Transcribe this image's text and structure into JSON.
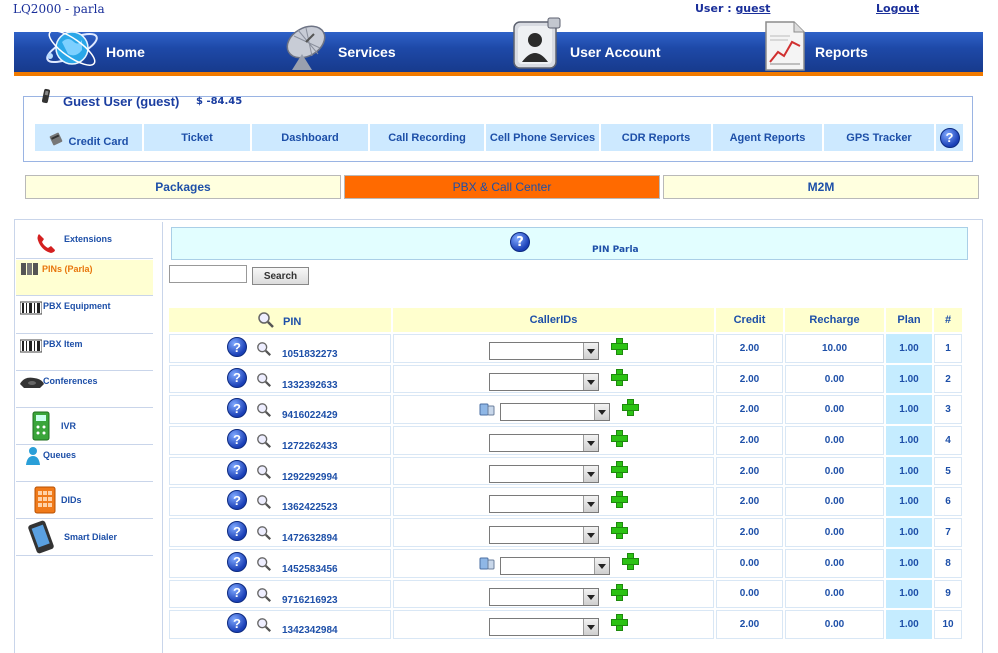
{
  "header": {
    "site_title": "LQ2000 - parla",
    "user_label": "User :",
    "user_name": "guest",
    "logout": "Logout"
  },
  "nav": {
    "items": [
      {
        "label": "Home",
        "icon": "globe-icon"
      },
      {
        "label": "Services",
        "icon": "satellite-dish-icon"
      },
      {
        "label": "User Account",
        "icon": "user-account-icon"
      },
      {
        "label": "Reports",
        "icon": "report-chart-icon"
      }
    ]
  },
  "profile": {
    "name": "Guest User (guest)",
    "balance": "$ -84.45"
  },
  "subtabs": [
    {
      "label": "Credit Card"
    },
    {
      "label": "Ticket"
    },
    {
      "label": "Dashboard"
    },
    {
      "label": "Call Recording"
    },
    {
      "label": "Cell Phone Services"
    },
    {
      "label": "CDR Reports"
    },
    {
      "label": "Agent Reports"
    },
    {
      "label": "GPS Tracker"
    }
  ],
  "bigtabs": [
    {
      "label": "Packages",
      "active": false
    },
    {
      "label": "PBX & Call Center",
      "active": true
    },
    {
      "label": "M2M",
      "active": false
    }
  ],
  "sidebar": {
    "items": [
      {
        "label": "Extensions"
      },
      {
        "label": "PINs (Parla)"
      },
      {
        "label": "PBX Equipment"
      },
      {
        "label": "PBX Item"
      },
      {
        "label": "Conferences"
      },
      {
        "label": "IVR"
      },
      {
        "label": "Queues"
      },
      {
        "label": "DIDs"
      },
      {
        "label": "Smart Dialer"
      }
    ]
  },
  "panel": {
    "title": "PIN Parla",
    "search_button": "Search",
    "search_value": ""
  },
  "table": {
    "headers": {
      "pin": "PIN",
      "callerids": "CallerIDs",
      "credit": "Credit",
      "recharge": "Recharge",
      "plan": "Plan",
      "num": "#"
    },
    "rows": [
      {
        "pin": "1051832273",
        "credit": "2.00",
        "recharge": "10.00",
        "plan": "1.00",
        "num": "1",
        "phone": false
      },
      {
        "pin": "1332392633",
        "credit": "2.00",
        "recharge": "0.00",
        "plan": "1.00",
        "num": "2",
        "phone": false
      },
      {
        "pin": "9416022429",
        "credit": "2.00",
        "recharge": "0.00",
        "plan": "1.00",
        "num": "3",
        "phone": true
      },
      {
        "pin": "1272262433",
        "credit": "2.00",
        "recharge": "0.00",
        "plan": "1.00",
        "num": "4",
        "phone": false
      },
      {
        "pin": "1292292994",
        "credit": "2.00",
        "recharge": "0.00",
        "plan": "1.00",
        "num": "5",
        "phone": false
      },
      {
        "pin": "1362422523",
        "credit": "2.00",
        "recharge": "0.00",
        "plan": "1.00",
        "num": "6",
        "phone": false
      },
      {
        "pin": "1472632894",
        "credit": "2.00",
        "recharge": "0.00",
        "plan": "1.00",
        "num": "7",
        "phone": false
      },
      {
        "pin": "1452583456",
        "credit": "0.00",
        "recharge": "0.00",
        "plan": "1.00",
        "num": "8",
        "phone": true
      },
      {
        "pin": "9716216923",
        "credit": "0.00",
        "recharge": "0.00",
        "plan": "1.00",
        "num": "9",
        "phone": false
      },
      {
        "pin": "1342342984",
        "credit": "2.00",
        "recharge": "0.00",
        "plan": "1.00",
        "num": "10",
        "phone": false
      }
    ]
  },
  "colors": {
    "nav_blue": "#1e49a8",
    "accent_orange": "#ff6a00",
    "link_blue": "#1d4fa8",
    "plus_green": "#2cc214"
  }
}
